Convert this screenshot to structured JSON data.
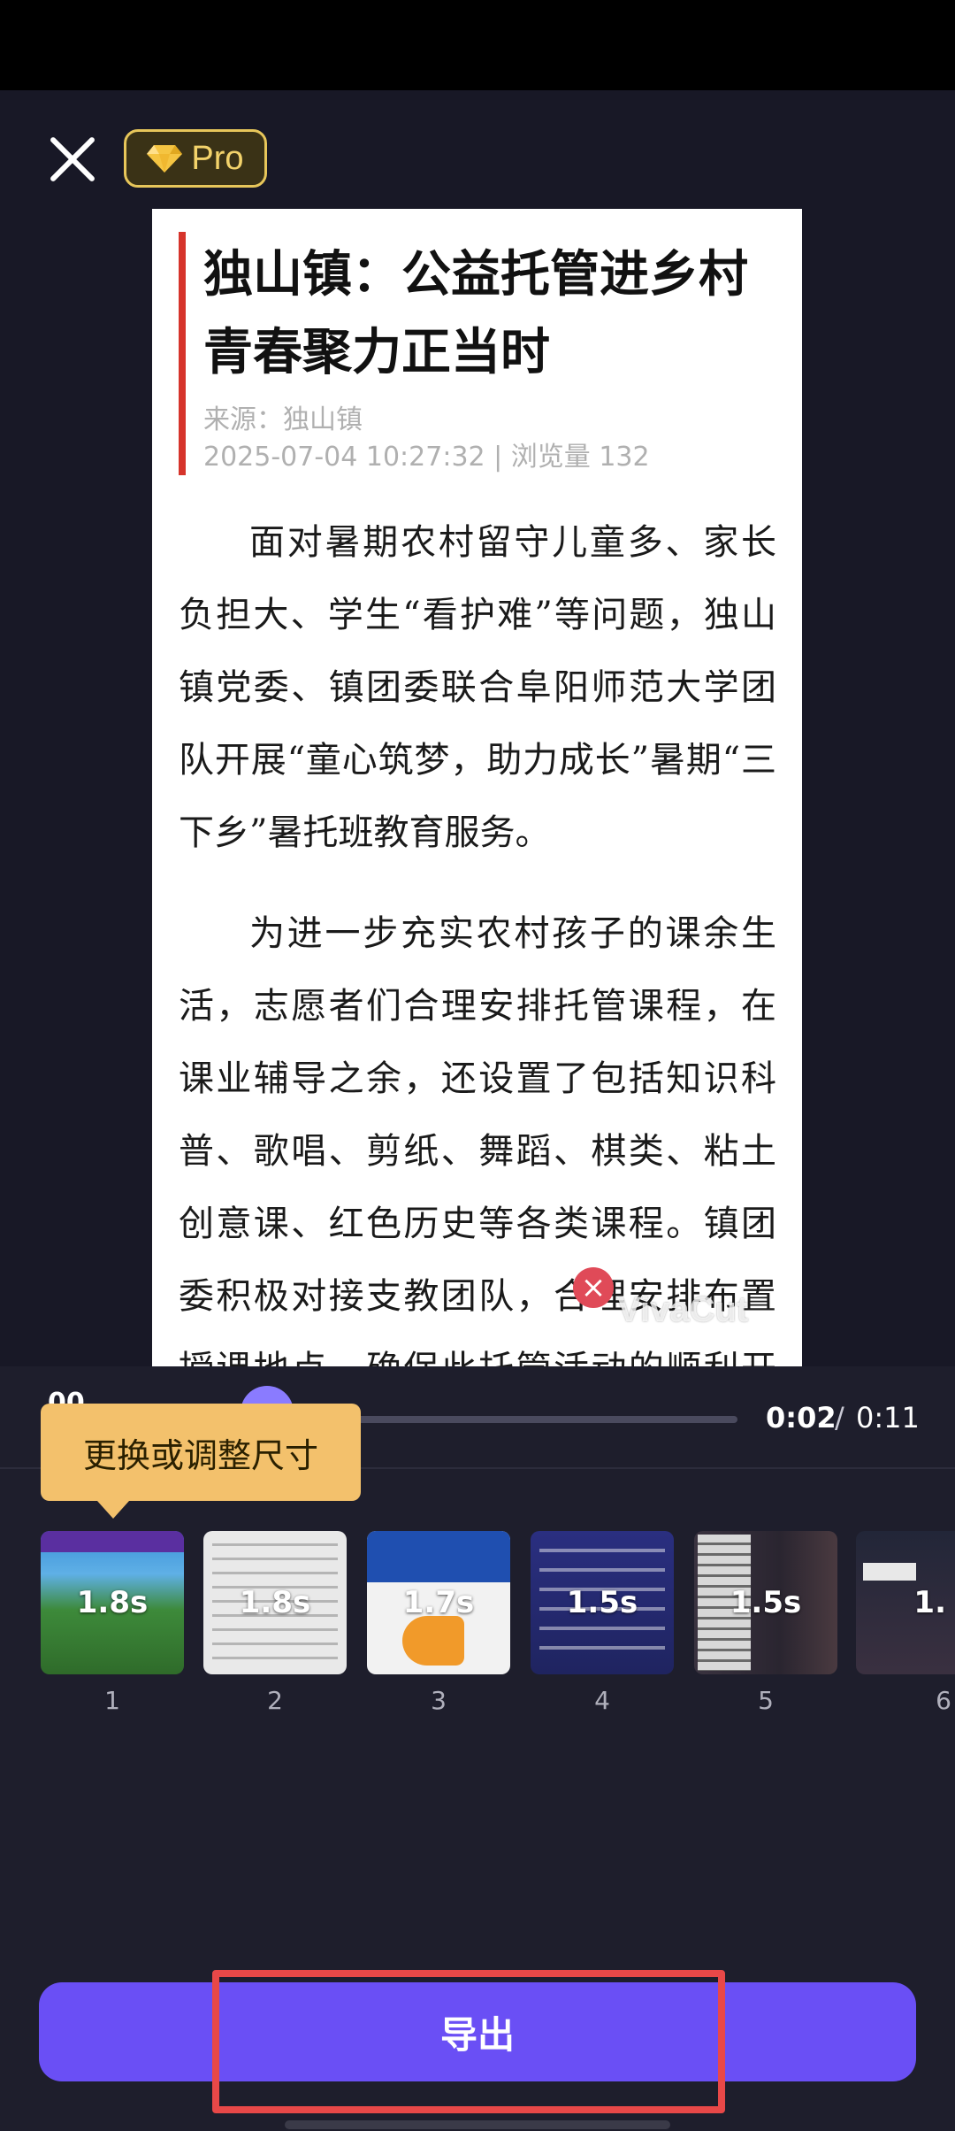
{
  "toolbar": {
    "pro_label": "Pro"
  },
  "article": {
    "title": "独山镇：公益托管进乡村青春聚力正当时",
    "source": "来源：独山镇",
    "meta": "2025-07-04 10:27:32 | 浏览量 132",
    "paragraphs": [
      "面对暑期农村留守儿童多、家长负担大、学生“看护难”等问题，独山镇党委、镇团委联合阜阳师范大学团队开展“童心筑梦，助力成长”暑期“三下乡”暑托班教育服务。",
      "为进一步充实农村孩子的课余生活，志愿者们合理安排托管课程，在课业辅导之余，还设置了包括知识科普、歌唱、剪纸、舞蹈、棋类、粘土创意课、红色历史等各类课程。镇团委积极对接支教团队，合理安排布置授课地点，确保此托管活动的顺利开展。"
    ]
  },
  "watermark": {
    "text": "VivaCut"
  },
  "playback": {
    "current": "0:02",
    "separator": "/",
    "total": "0:11",
    "progress": 0.18
  },
  "tooltip": {
    "text": "更换或调整尺寸"
  },
  "clips": [
    {
      "index": "1",
      "duration": "1.8s"
    },
    {
      "index": "2",
      "duration": "1.8s"
    },
    {
      "index": "3",
      "duration": "1.7s"
    },
    {
      "index": "4",
      "duration": "1.5s"
    },
    {
      "index": "5",
      "duration": "1.5s"
    },
    {
      "index": "6",
      "duration": "1."
    }
  ],
  "export": {
    "label": "导出"
  },
  "colors": {
    "accent": "#6a4ff5",
    "tooltip": "#f3c16c",
    "highlight": "#e84848",
    "pro": "#e7c65a"
  }
}
